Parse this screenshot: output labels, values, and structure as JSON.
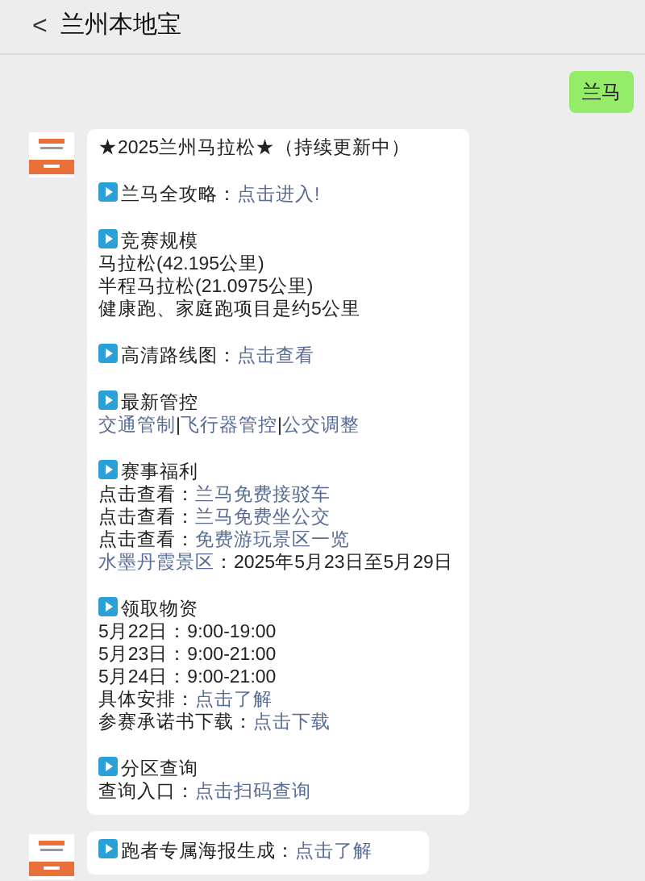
{
  "header": {
    "back": "<",
    "title": "兰州本地宝"
  },
  "messages": [
    {
      "kind": "outgoing",
      "paragraphs": [
        [
          {
            "kind": "plain",
            "parts": [
              {
                "text": "兰马",
                "link": false
              }
            ]
          }
        ]
      ]
    },
    {
      "kind": "incoming",
      "paragraphs": [
        [
          {
            "kind": "plain",
            "parts": [
              {
                "text": "★2025兰州马拉松★（持续更新中）",
                "link": false
              }
            ]
          }
        ],
        [
          {
            "kind": "heading",
            "parts": [
              {
                "text": "兰马全攻略：",
                "link": false
              },
              {
                "text": "点击进入!",
                "link": true
              }
            ]
          }
        ],
        [
          {
            "kind": "heading",
            "parts": [
              {
                "text": "竞赛规模",
                "link": false
              }
            ]
          },
          {
            "kind": "plain",
            "parts": [
              {
                "text": "马拉松(42.195公里)",
                "link": false
              }
            ]
          },
          {
            "kind": "plain",
            "parts": [
              {
                "text": "半程马拉松(21.0975公里)",
                "link": false
              }
            ]
          },
          {
            "kind": "plain",
            "parts": [
              {
                "text": "健康跑、家庭跑项目是约5公里",
                "link": false
              }
            ]
          }
        ],
        [
          {
            "kind": "heading",
            "parts": [
              {
                "text": "高清路线图：",
                "link": false
              },
              {
                "text": "点击查看",
                "link": true
              }
            ]
          }
        ],
        [
          {
            "kind": "heading",
            "parts": [
              {
                "text": "最新管控",
                "link": false
              }
            ]
          },
          {
            "kind": "plain",
            "parts": [
              {
                "text": "交通管制",
                "link": true
              },
              {
                "text": "|",
                "link": false
              },
              {
                "text": "飞行器管控",
                "link": true
              },
              {
                "text": "|",
                "link": false
              },
              {
                "text": "公交调整",
                "link": true
              }
            ]
          }
        ],
        [
          {
            "kind": "heading",
            "parts": [
              {
                "text": "赛事福利",
                "link": false
              }
            ]
          },
          {
            "kind": "plain",
            "parts": [
              {
                "text": "点击查看：",
                "link": false
              },
              {
                "text": "兰马免费接驳车",
                "link": true
              }
            ]
          },
          {
            "kind": "plain",
            "parts": [
              {
                "text": "点击查看：",
                "link": false
              },
              {
                "text": "兰马免费坐公交",
                "link": true
              }
            ]
          },
          {
            "kind": "plain",
            "parts": [
              {
                "text": "点击查看：",
                "link": false
              },
              {
                "text": "免费游玩景区一览",
                "link": true
              }
            ]
          },
          {
            "kind": "plain",
            "parts": [
              {
                "text": "水墨丹霞景区",
                "link": true
              },
              {
                "text": "：2025年5月23日至5月29日",
                "link": false
              }
            ]
          }
        ],
        [
          {
            "kind": "heading",
            "parts": [
              {
                "text": "领取物资",
                "link": false
              }
            ]
          },
          {
            "kind": "plain",
            "parts": [
              {
                "text": "5月22日：9:00-19:00",
                "link": false
              }
            ]
          },
          {
            "kind": "plain",
            "parts": [
              {
                "text": "5月23日：9:00-21:00",
                "link": false
              }
            ]
          },
          {
            "kind": "plain",
            "parts": [
              {
                "text": "5月24日：9:00-21:00",
                "link": false
              }
            ]
          },
          {
            "kind": "plain",
            "parts": [
              {
                "text": "具体安排：",
                "link": false
              },
              {
                "text": "点击了解",
                "link": true
              }
            ]
          },
          {
            "kind": "plain",
            "parts": [
              {
                "text": "参赛承诺书下载：",
                "link": false
              },
              {
                "text": "点击下载",
                "link": true
              }
            ]
          }
        ],
        [
          {
            "kind": "heading",
            "parts": [
              {
                "text": "分区查询",
                "link": false
              }
            ]
          },
          {
            "kind": "plain",
            "parts": [
              {
                "text": "查询入口：",
                "link": false
              },
              {
                "text": "点击扫码查询",
                "link": true
              }
            ]
          }
        ]
      ]
    },
    {
      "kind": "incoming",
      "paragraphs": [
        [
          {
            "kind": "heading",
            "parts": [
              {
                "text": "跑者专属海报生成：",
                "link": false
              },
              {
                "text": "点击了解",
                "link": true
              }
            ]
          }
        ]
      ]
    }
  ]
}
